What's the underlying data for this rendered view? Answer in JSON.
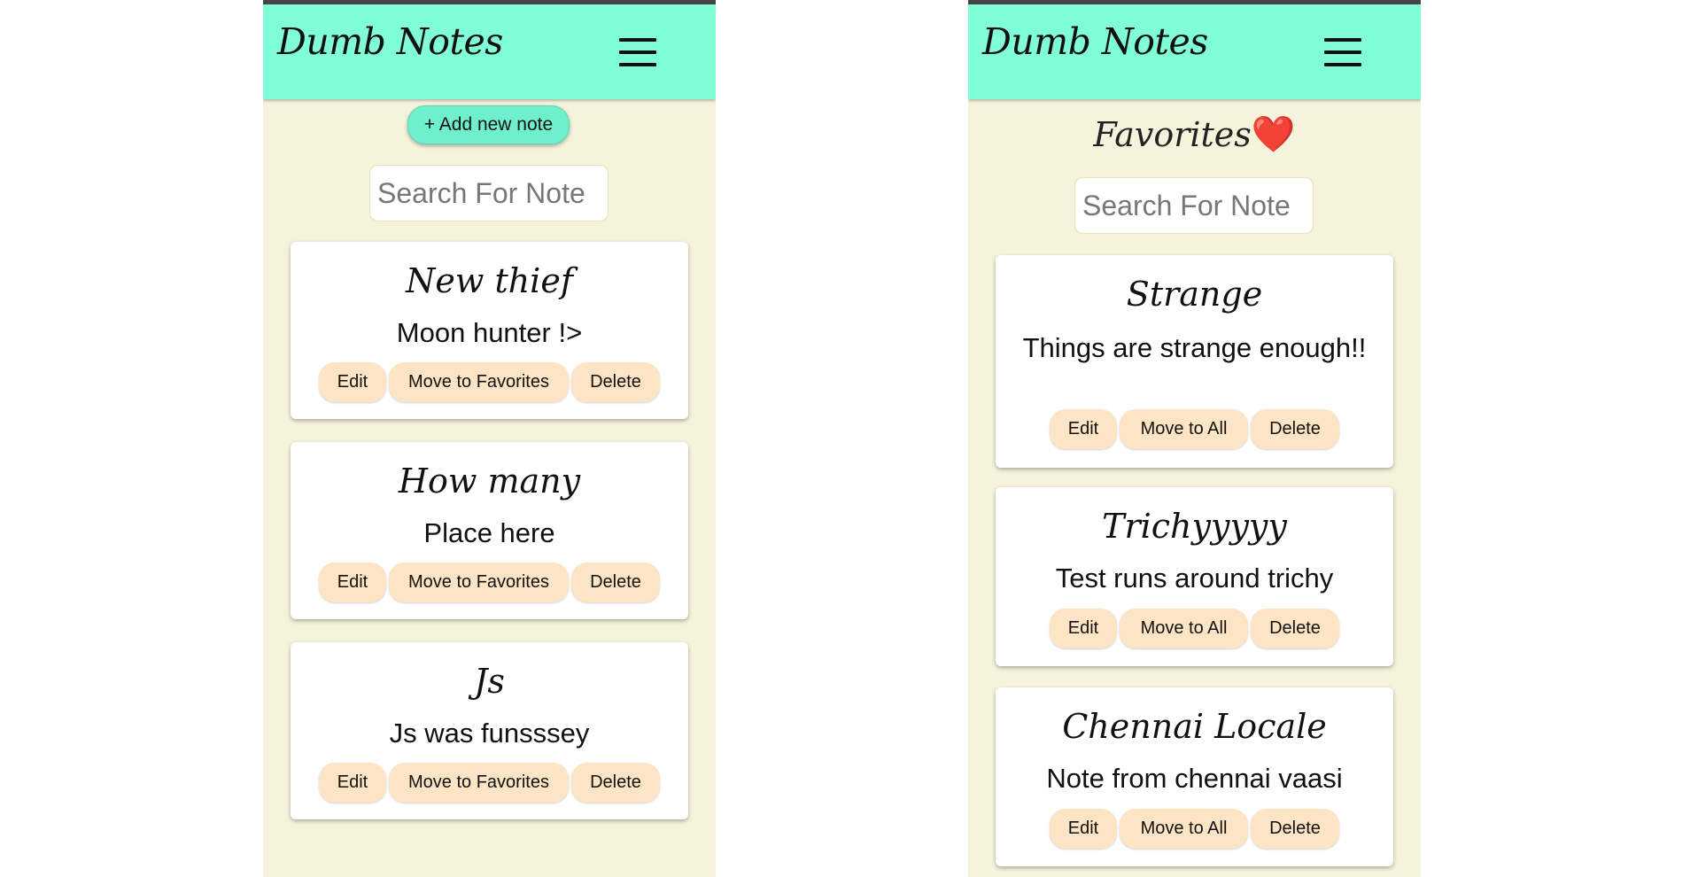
{
  "screens": [
    {
      "brand": "Dumb Notes",
      "add_button": "+ Add new note",
      "search_placeholder": "Search For Note",
      "notes": [
        {
          "title": "New thief",
          "body": "Moon hunter !>",
          "edit": "Edit",
          "move": "Move to Favorites",
          "delete": "Delete"
        },
        {
          "title": "How many",
          "body": "Place here",
          "edit": "Edit",
          "move": "Move to Favorites",
          "delete": "Delete"
        },
        {
          "title": "Js",
          "body": "Js was funsssey",
          "edit": "Edit",
          "move": "Move to Favorites",
          "delete": "Delete"
        }
      ]
    },
    {
      "brand": "Dumb Notes",
      "heading": "Favorites",
      "heading_emoji": "❤️",
      "search_placeholder": "Search For Note",
      "notes": [
        {
          "title": "Strange",
          "body": "Things are strange enough!!",
          "edit": "Edit",
          "move": "Move to All",
          "delete": "Delete"
        },
        {
          "title": "Trichyyyyy",
          "body": "Test runs around trichy",
          "edit": "Edit",
          "move": "Move to All",
          "delete": "Delete"
        },
        {
          "title": "Chennai Locale",
          "body": "Note from chennai vaasi",
          "edit": "Edit",
          "move": "Move to All",
          "delete": "Delete"
        }
      ]
    }
  ],
  "icons": {
    "menu": "hamburger-menu-icon"
  },
  "colors": {
    "appbar": "#80ffd6",
    "background": "#f5f3dc",
    "add_button": "#6ff0cc",
    "action_button": "#fde4c4",
    "heart": "#e0102a"
  }
}
